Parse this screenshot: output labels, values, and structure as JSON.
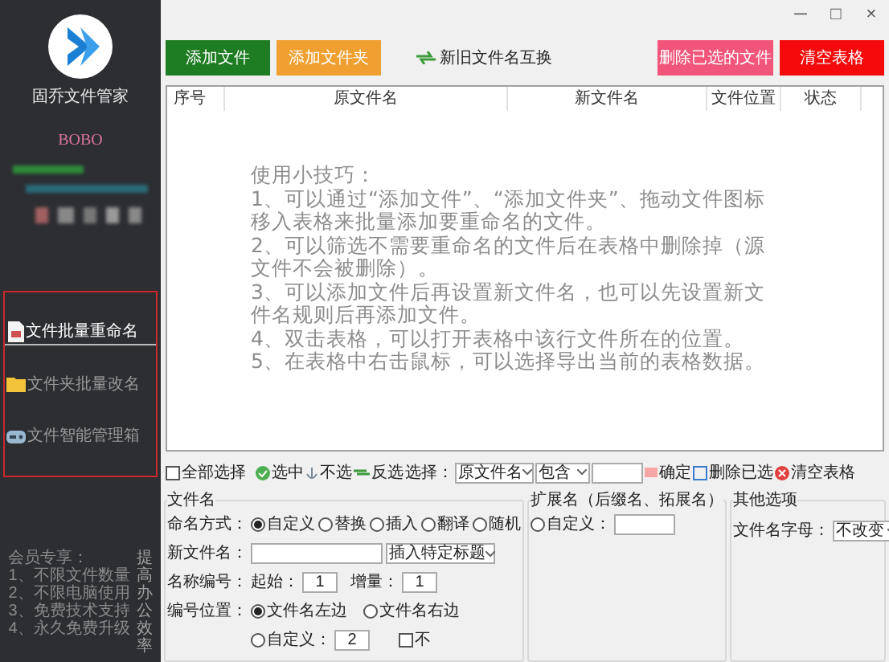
{
  "window_controls": [
    "─",
    "□",
    "×"
  ],
  "sidebar": {
    "app_title": "固乔文件管家",
    "user": "BOBO",
    "menu": [
      {
        "label": "文件批量重命名",
        "selected": true
      },
      {
        "label": "文件夹批量改名",
        "selected": false
      },
      {
        "label": "文件智能管理箱",
        "selected": false
      }
    ],
    "membership": [
      "会员专享：",
      "1、不限文件数量",
      "2、不限电脑使用",
      "3、免费技术支持",
      "4、永久免费升级"
    ],
    "slogan": "提高办公效率"
  },
  "actions": [
    {
      "label": "添加文件",
      "kind": "filled",
      "color": "#1e7d22"
    },
    {
      "label": "添加文件夹",
      "kind": "filled",
      "color": "#f0a030"
    },
    {
      "label": "新旧文件名互换",
      "kind": "plain"
    },
    {
      "label": "删除已选的文件",
      "kind": "filled",
      "color": "#f2557a"
    },
    {
      "label": "清空表格",
      "kind": "filled",
      "color": "#f40a0a"
    }
  ],
  "table": {
    "columns": [
      "序号",
      "原文件名",
      "新文件名",
      "文件位置",
      "状态"
    ],
    "tips": [
      "使用小技巧：",
      "1、可以通过“添加文件”、“添加文件夹”、拖动文件图标移入表格来批量添加要重命名的文件。",
      "2、可以筛选不需要重命名的文件后在表格中删除掉（源文件不会被删除）。",
      "3、可以添加文件后再设置新文件名，也可以先设置新文件名规则后再添加文件。",
      "4、双击表格，可以打开表格中该行文件所在的位置。",
      "5、在表格中右击鼠标，可以选择导出当前的表格数据。"
    ]
  },
  "selection_bar": {
    "select_all": {
      "label": "全部选择",
      "checked": false
    },
    "select": "选中",
    "deselect": "不选",
    "invert": "反选",
    "filter_label": "选择：",
    "filter_field": "原文件名",
    "filter_mode": "包含",
    "confirm": "确定",
    "delete_selected": "删除已选",
    "clear": "清空表格"
  },
  "filename_group": {
    "title": "文件名",
    "naming_label": "命名方式：",
    "naming_modes": [
      {
        "label": "自定义",
        "selected": true
      },
      {
        "label": "替换",
        "selected": false
      },
      {
        "label": "插入",
        "selected": false
      },
      {
        "label": "翻译",
        "selected": false
      },
      {
        "label": "随机",
        "selected": false
      }
    ],
    "new_name_label": "新文件名：",
    "insert_dropdown": "插入特定标题",
    "number_label": "名称编号：",
    "start_label": "起始：",
    "start_value": "1",
    "step_label": "增量：",
    "step_value": "1",
    "position_label": "编号位置：",
    "positions": [
      {
        "label": "文件名左边",
        "selected": true
      },
      {
        "label": "文件名右边",
        "selected": false
      },
      {
        "label": "自定义：",
        "selected": false
      }
    ],
    "custom_position_value": "2",
    "extra_option": {
      "label": "不",
      "checked": false
    }
  },
  "extension_group": {
    "title": "扩展名（后缀名、拓展名）",
    "custom": {
      "label": "自定义：",
      "selected": false
    }
  },
  "other_group": {
    "title": "其他选项",
    "letter_label": "文件名字母：",
    "letter_value": "不改变"
  }
}
